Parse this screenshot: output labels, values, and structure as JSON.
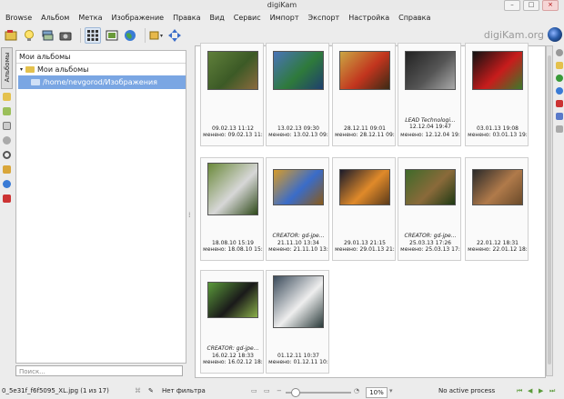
{
  "window": {
    "title": "digiKam",
    "btn_min": "–",
    "btn_max": "□",
    "btn_close": "×"
  },
  "menu": [
    "Browse",
    "Альбом",
    "Метка",
    "Изображение",
    "Правка",
    "Вид",
    "Сервис",
    "Импорт",
    "Экспорт",
    "Настройка",
    "Справка"
  ],
  "toolbar": {
    "brand_text": "digiKam.org"
  },
  "left_tab": {
    "label": "Альбомы"
  },
  "album_panel": {
    "header": "Мои альбомы",
    "root": "Мои альбомы",
    "child": "/home/nevgorod/Изображения"
  },
  "search": {
    "placeholder": "Поиск..."
  },
  "thumbs": [
    {
      "title": "",
      "line1": "09.02.13 11:12",
      "line2": "менено: 09.02.13 11:",
      "colors": [
        "#5f7f3a",
        "#3c5a26",
        "#8b6a3e"
      ]
    },
    {
      "title": "",
      "line1": "13.02.13 09:30",
      "line2": "менено: 13.02.13 09:",
      "colors": [
        "#4a74b8",
        "#2e7a3b",
        "#1f3f6e"
      ]
    },
    {
      "title": "",
      "line1": "28.12.11 09:01",
      "line2": "менено: 28.12.11 09:",
      "colors": [
        "#caa642",
        "#c2351e",
        "#3a2a15"
      ]
    },
    {
      "title": "LEAD Technologi...",
      "line1": "12.12.04 19:47",
      "line2": "менено: 12.12.04 19:",
      "colors": [
        "#222222",
        "#555555",
        "#aaaaaa"
      ]
    },
    {
      "title": "",
      "line1": "03.01.13 19:08",
      "line2": "менено: 03.01.13 19:",
      "colors": [
        "#111111",
        "#c81c1c",
        "#3b7a2a"
      ]
    },
    {
      "title": "",
      "line1": "18.08.10 15:19",
      "line2": "менено: 18.08.10 15:",
      "colors": [
        "#6b8a3a",
        "#d7d7d7",
        "#2f4a1a"
      ]
    },
    {
      "title": "CREATOR: gd-jpe...",
      "line1": "21.11.10 13:34",
      "line2": "менено: 21.11.10 13:",
      "colors": [
        "#d69b2a",
        "#3a6cc9",
        "#8a5a18"
      ]
    },
    {
      "title": "",
      "line1": "29.01.13 21:15",
      "line2": "менено: 29.01.13 21:",
      "colors": [
        "#1a1a2a",
        "#e08a2a",
        "#5a3a1a"
      ]
    },
    {
      "title": "CREATOR: gd-jpe...",
      "line1": "25.03.13 17:26",
      "line2": "менено: 25.03.13 17:",
      "colors": [
        "#3f6a2a",
        "#8a6a3a",
        "#1f3a14"
      ]
    },
    {
      "title": "",
      "line1": "22.01.12 18:31",
      "line2": "менено: 22.01.12 18:",
      "colors": [
        "#2a2a2a",
        "#b07a4a",
        "#6a4a2a"
      ]
    },
    {
      "title": "CREATOR: gd-jpe...",
      "line1": "16.02.12 18:33",
      "line2": "менено: 16.02.12 18:",
      "colors": [
        "#5a9a3a",
        "#1a1a1a",
        "#8ab04a"
      ]
    },
    {
      "title": "",
      "line1": "01.12.11 10:37",
      "line2": "менено: 01.12.11 10:",
      "colors": [
        "#3a4a5a",
        "#eeeeee",
        "#2a3a3a"
      ]
    }
  ],
  "status": {
    "file": "0_5e31f_f6f5095_XL.jpg (1 из 17)",
    "filter": "Нет фильтра",
    "zoom": "10%",
    "process": "No active process"
  },
  "colors": {
    "accent": "#7aa6e3",
    "selection_border": "#9db7d6"
  }
}
